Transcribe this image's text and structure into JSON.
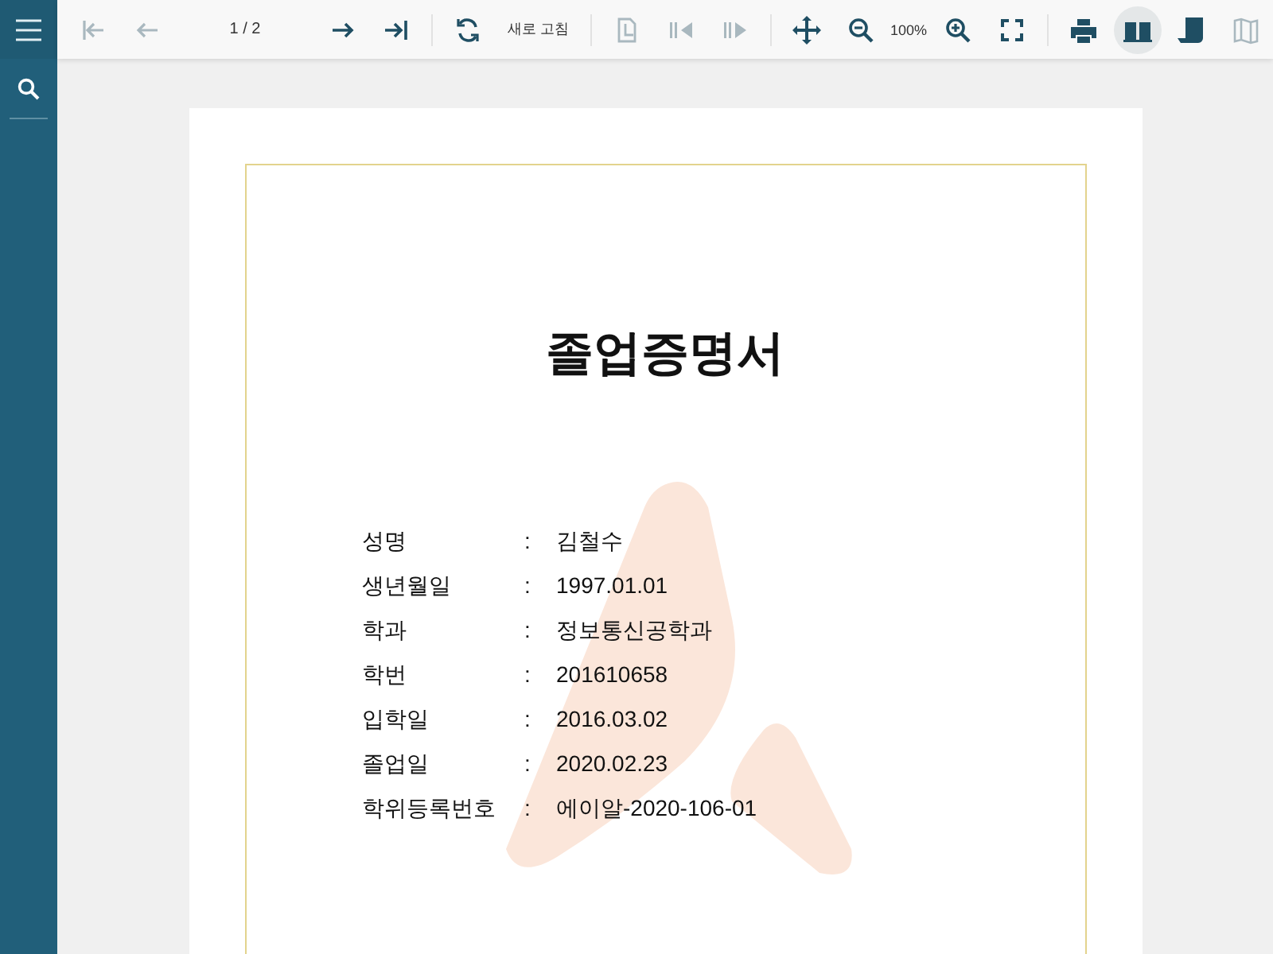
{
  "toolbar": {
    "items": [
      {
        "kind": "first",
        "disabled": true
      },
      {
        "kind": "prev",
        "disabled": true
      },
      {
        "kind": "page",
        "text": "1 / 2"
      },
      {
        "kind": "next",
        "disabled": false
      },
      {
        "kind": "last",
        "disabled": false
      },
      {
        "kind": "sep"
      },
      {
        "kind": "refresh",
        "disabled": false
      },
      {
        "kind": "label",
        "text": "새로 고침"
      },
      {
        "kind": "sep"
      },
      {
        "kind": "export",
        "disabled": true
      },
      {
        "kind": "back",
        "disabled": true
      },
      {
        "kind": "forward",
        "disabled": true
      },
      {
        "kind": "sep"
      },
      {
        "kind": "pan",
        "disabled": false
      },
      {
        "kind": "zoomout",
        "disabled": false
      },
      {
        "kind": "zoom",
        "text": "100%"
      },
      {
        "kind": "zoomin",
        "disabled": false
      },
      {
        "kind": "fullscreen",
        "disabled": false
      },
      {
        "kind": "sep"
      },
      {
        "kind": "print",
        "disabled": false
      },
      {
        "kind": "book",
        "disabled": false,
        "selected": true
      },
      {
        "kind": "scroll",
        "disabled": false,
        "selected": false
      },
      {
        "kind": "map",
        "disabled": true,
        "selected": false
      }
    ]
  },
  "document": {
    "title": "졸업증명서",
    "fields": [
      {
        "label": "성명",
        "value": "김철수"
      },
      {
        "label": "생년월일",
        "value": "1997.01.01"
      },
      {
        "label": "학과",
        "value": "정보통신공학과"
      },
      {
        "label": "학번",
        "value": "201610658"
      },
      {
        "label": "입학일",
        "value": "2016.03.02"
      },
      {
        "label": "졸업일",
        "value": "2020.02.23"
      },
      {
        "label": "학위등록번호",
        "value": "에이알-2020-106-01"
      }
    ],
    "separator": ":"
  }
}
